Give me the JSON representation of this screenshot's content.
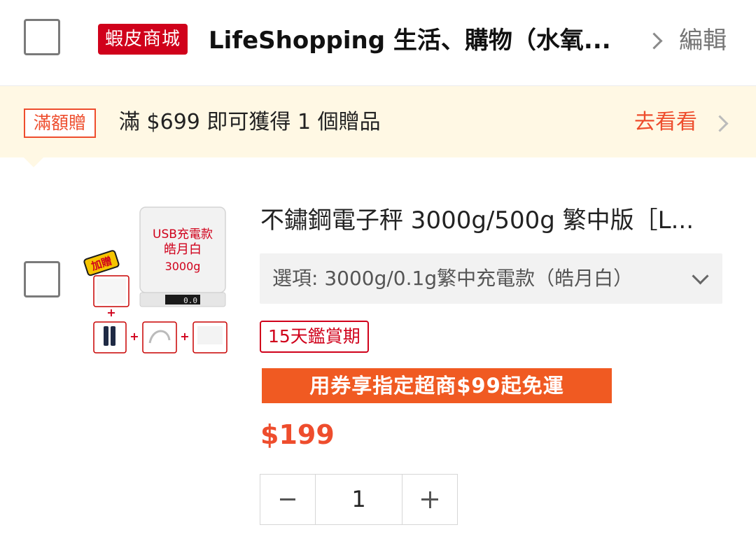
{
  "shop": {
    "mall_badge": "蝦皮商城",
    "name": "LifeShopping 生活、購物（水氧...",
    "edit_label": "編輯"
  },
  "promo": {
    "tag": "滿額贈",
    "text": "滿 $699 即可獲得 1 個贈品",
    "link": "去看看"
  },
  "product": {
    "name": "不鏽鋼電子秤 3000g/500g 繁中版［L...",
    "variation": "選項: 3000g/0.1g繁中充電款（皓月白）",
    "trial_tag": "15天鑑賞期",
    "shipping_banner": "用券享指定超商$99起免運",
    "price": "$199",
    "quantity": "1",
    "image_text": {
      "usb_label": "USB充電款",
      "color_label": "皓月白",
      "weight_label": "3000g",
      "gift_label": "加贈",
      "scale_display": "0.0"
    }
  },
  "colors": {
    "accent": "#ee4d2d",
    "mall_red": "#d0011b",
    "promo_bg": "#fff8e4",
    "ship_banner": "#f05a22"
  }
}
